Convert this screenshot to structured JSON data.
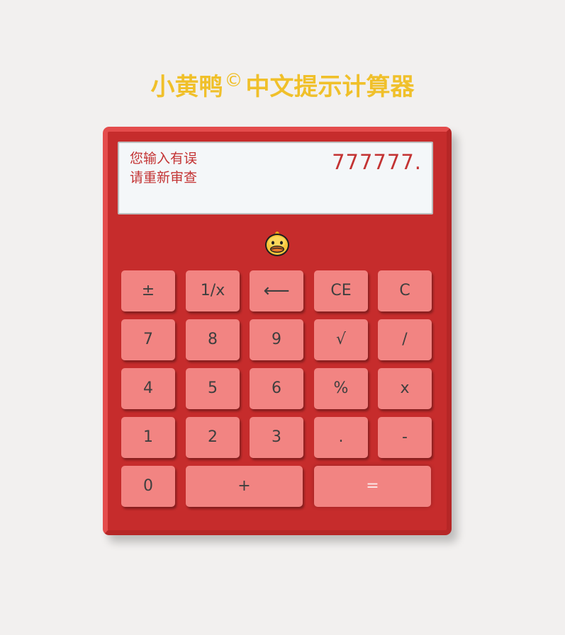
{
  "title": {
    "main": "小黄鸭",
    "mark": "©",
    "sub": "中文提示计算器"
  },
  "display": {
    "message_line1": "您输入有误",
    "message_line2": "请重新审查",
    "value": "777777."
  },
  "logo": {
    "icon": "duck-icon"
  },
  "colors": {
    "title": "#f0c02a",
    "body": "#c62c2c",
    "button": "#f28482",
    "display_text": "#c33333"
  },
  "keys": {
    "negate": "±",
    "reciprocal": "1/x",
    "backspace": "⟵",
    "ce": "CE",
    "c": "C",
    "seven": "7",
    "eight": "8",
    "nine": "9",
    "sqrt": "√",
    "divide": "/",
    "four": "4",
    "five": "5",
    "six": "6",
    "percent": "%",
    "multiply": "x",
    "one": "1",
    "two": "2",
    "three": "3",
    "dot": ".",
    "minus": "-",
    "zero": "0",
    "plus": "+",
    "equals": "="
  }
}
